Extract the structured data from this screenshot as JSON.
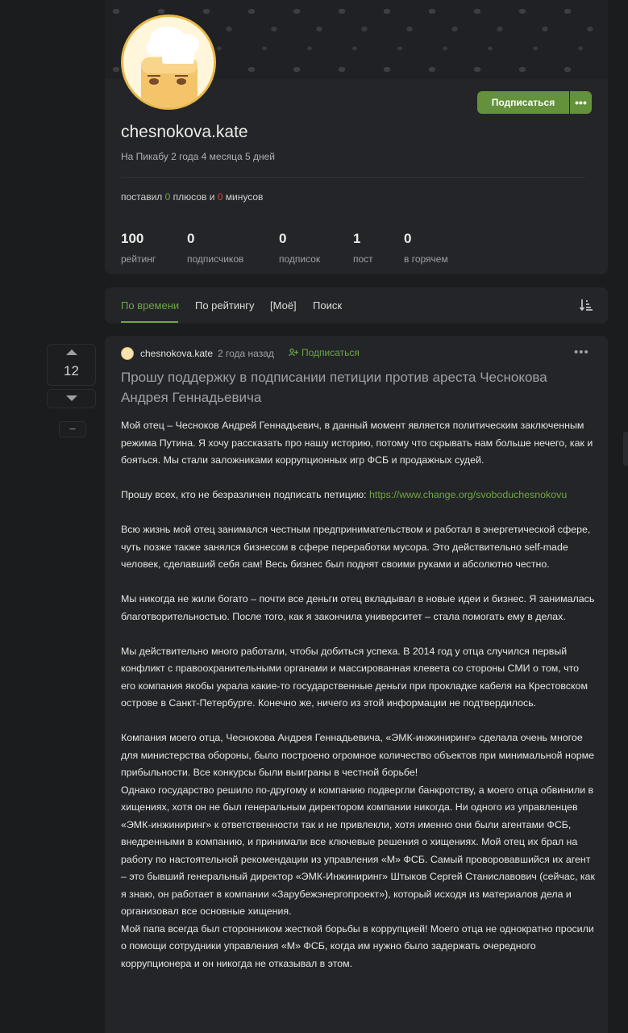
{
  "profile": {
    "username": "chesnokova.kate",
    "since": "На Пикабу 2 года 4 месяца 5 дней",
    "subscribe_label": "Подписаться",
    "more_label": "•••",
    "votes": {
      "prefix": "поставил",
      "pluses": "0",
      "pluses_word": "плюсов и",
      "minuses": "0",
      "minuses_word": "минусов"
    },
    "stats": [
      {
        "value": "100",
        "label": "рейтинг"
      },
      {
        "value": "0",
        "label": "подписчиков"
      },
      {
        "value": "0",
        "label": "подписок"
      },
      {
        "value": "1",
        "label": "пост"
      },
      {
        "value": "0",
        "label": "в горячем"
      }
    ]
  },
  "tabs": [
    {
      "label": "По времени",
      "active": true
    },
    {
      "label": "По рейтингу"
    },
    {
      "label": "[Моё]"
    },
    {
      "label": "Поиск"
    }
  ],
  "story": {
    "rating": "12",
    "minus_label": "–",
    "author": "chesnokova.kate",
    "time": "2 года назад",
    "follow_label": "Подписаться",
    "title": "Прошу поддержку в подписании петиции против ареста Чеснокова Андрея Геннадьевича",
    "paragraphs": [
      "Мой отец – Чесноков Андрей Геннадьевич, в данный момент является политическим заключенным режима Путина. Я хочу рассказать про нашу историю, потому что скрывать нам больше нечего, как и бояться. Мы стали заложниками коррупционных игр ФСБ и продажных судей.",
      "Всю жизнь мой отец занимался честным предпринимательством и работал в энергетической сфере, чуть позже также занялся бизнесом в сфере переработки мусора. Это действительно self-made человек, сделавший себя сам! Весь бизнес был поднят своими руками и абсолютно честно.",
      "Мы никогда не жили богато – почти все деньги отец вкладывал в новые идеи и бизнес. Я занималась благотворительностью. После того, как я закончила университет – стала помогать ему в делах.",
      "Мы действительно много работали, чтобы добиться успеха. В 2014 год у отца случился первый конфликт с правоохранительными органами и массированная клевета со стороны СМИ о том, что его компания якобы украла какие-то государственные деньги при прокладке кабеля на Крестовском острове в Санкт-Петербурге. Конечно же, ничего из этой информации не подтвердилось.",
      "Компания моего отца, Чеснокова Андрея Геннадьевича, «ЭМК-инжиниринг» сделала очень многое для министерства обороны, было построено огромное количество объектов при минимальной норме прибыльности. Все конкурсы были выиграны в честной борьбе!",
      "Однако государство решило по-другому и компанию подвергли банкротству, а моего отца обвинили в хищениях, хотя он не был генеральным директором компании никогда. Ни одного из управленцев «ЭМК-инжиниринг» к ответственности так и не привлекли, хотя именно они были агентами ФСБ, внедренными в компанию, и принимали все ключевые решения о хищениях. Мой отец их брал на работу по настоятельной рекомендации из управления «М» ФСБ. Самый проворовавшийся их агент – это бывший генеральный директор «ЭМК-Инжиниринг» Штыков Сергей Станиславович (сейчас, как я знаю, он работает в компании «Зарубежэнергопроект»), который исходя из материалов дела и организовал все основные хищения.",
      "Мой папа всегда был сторонником жесткой борьбы в коррупцией! Моего отца не однократно просили о помощи сотрудники управления «М» ФСБ, когда им нужно было задержать очередного коррупционера и он никогда не отказывал в этом."
    ],
    "petition_text": "Прошу всех, кто не безразличен подписать петицию:",
    "petition_link": "https://www.change.org/svoboduchesnokovu"
  },
  "colors": {
    "accent": "#64913b",
    "link": "#6ea644",
    "minus": "#d04a3f"
  },
  "icons": [
    "up-arrow-icon",
    "down-arrow-icon",
    "sort-icon",
    "follow-icon",
    "more-dots-icon"
  ]
}
